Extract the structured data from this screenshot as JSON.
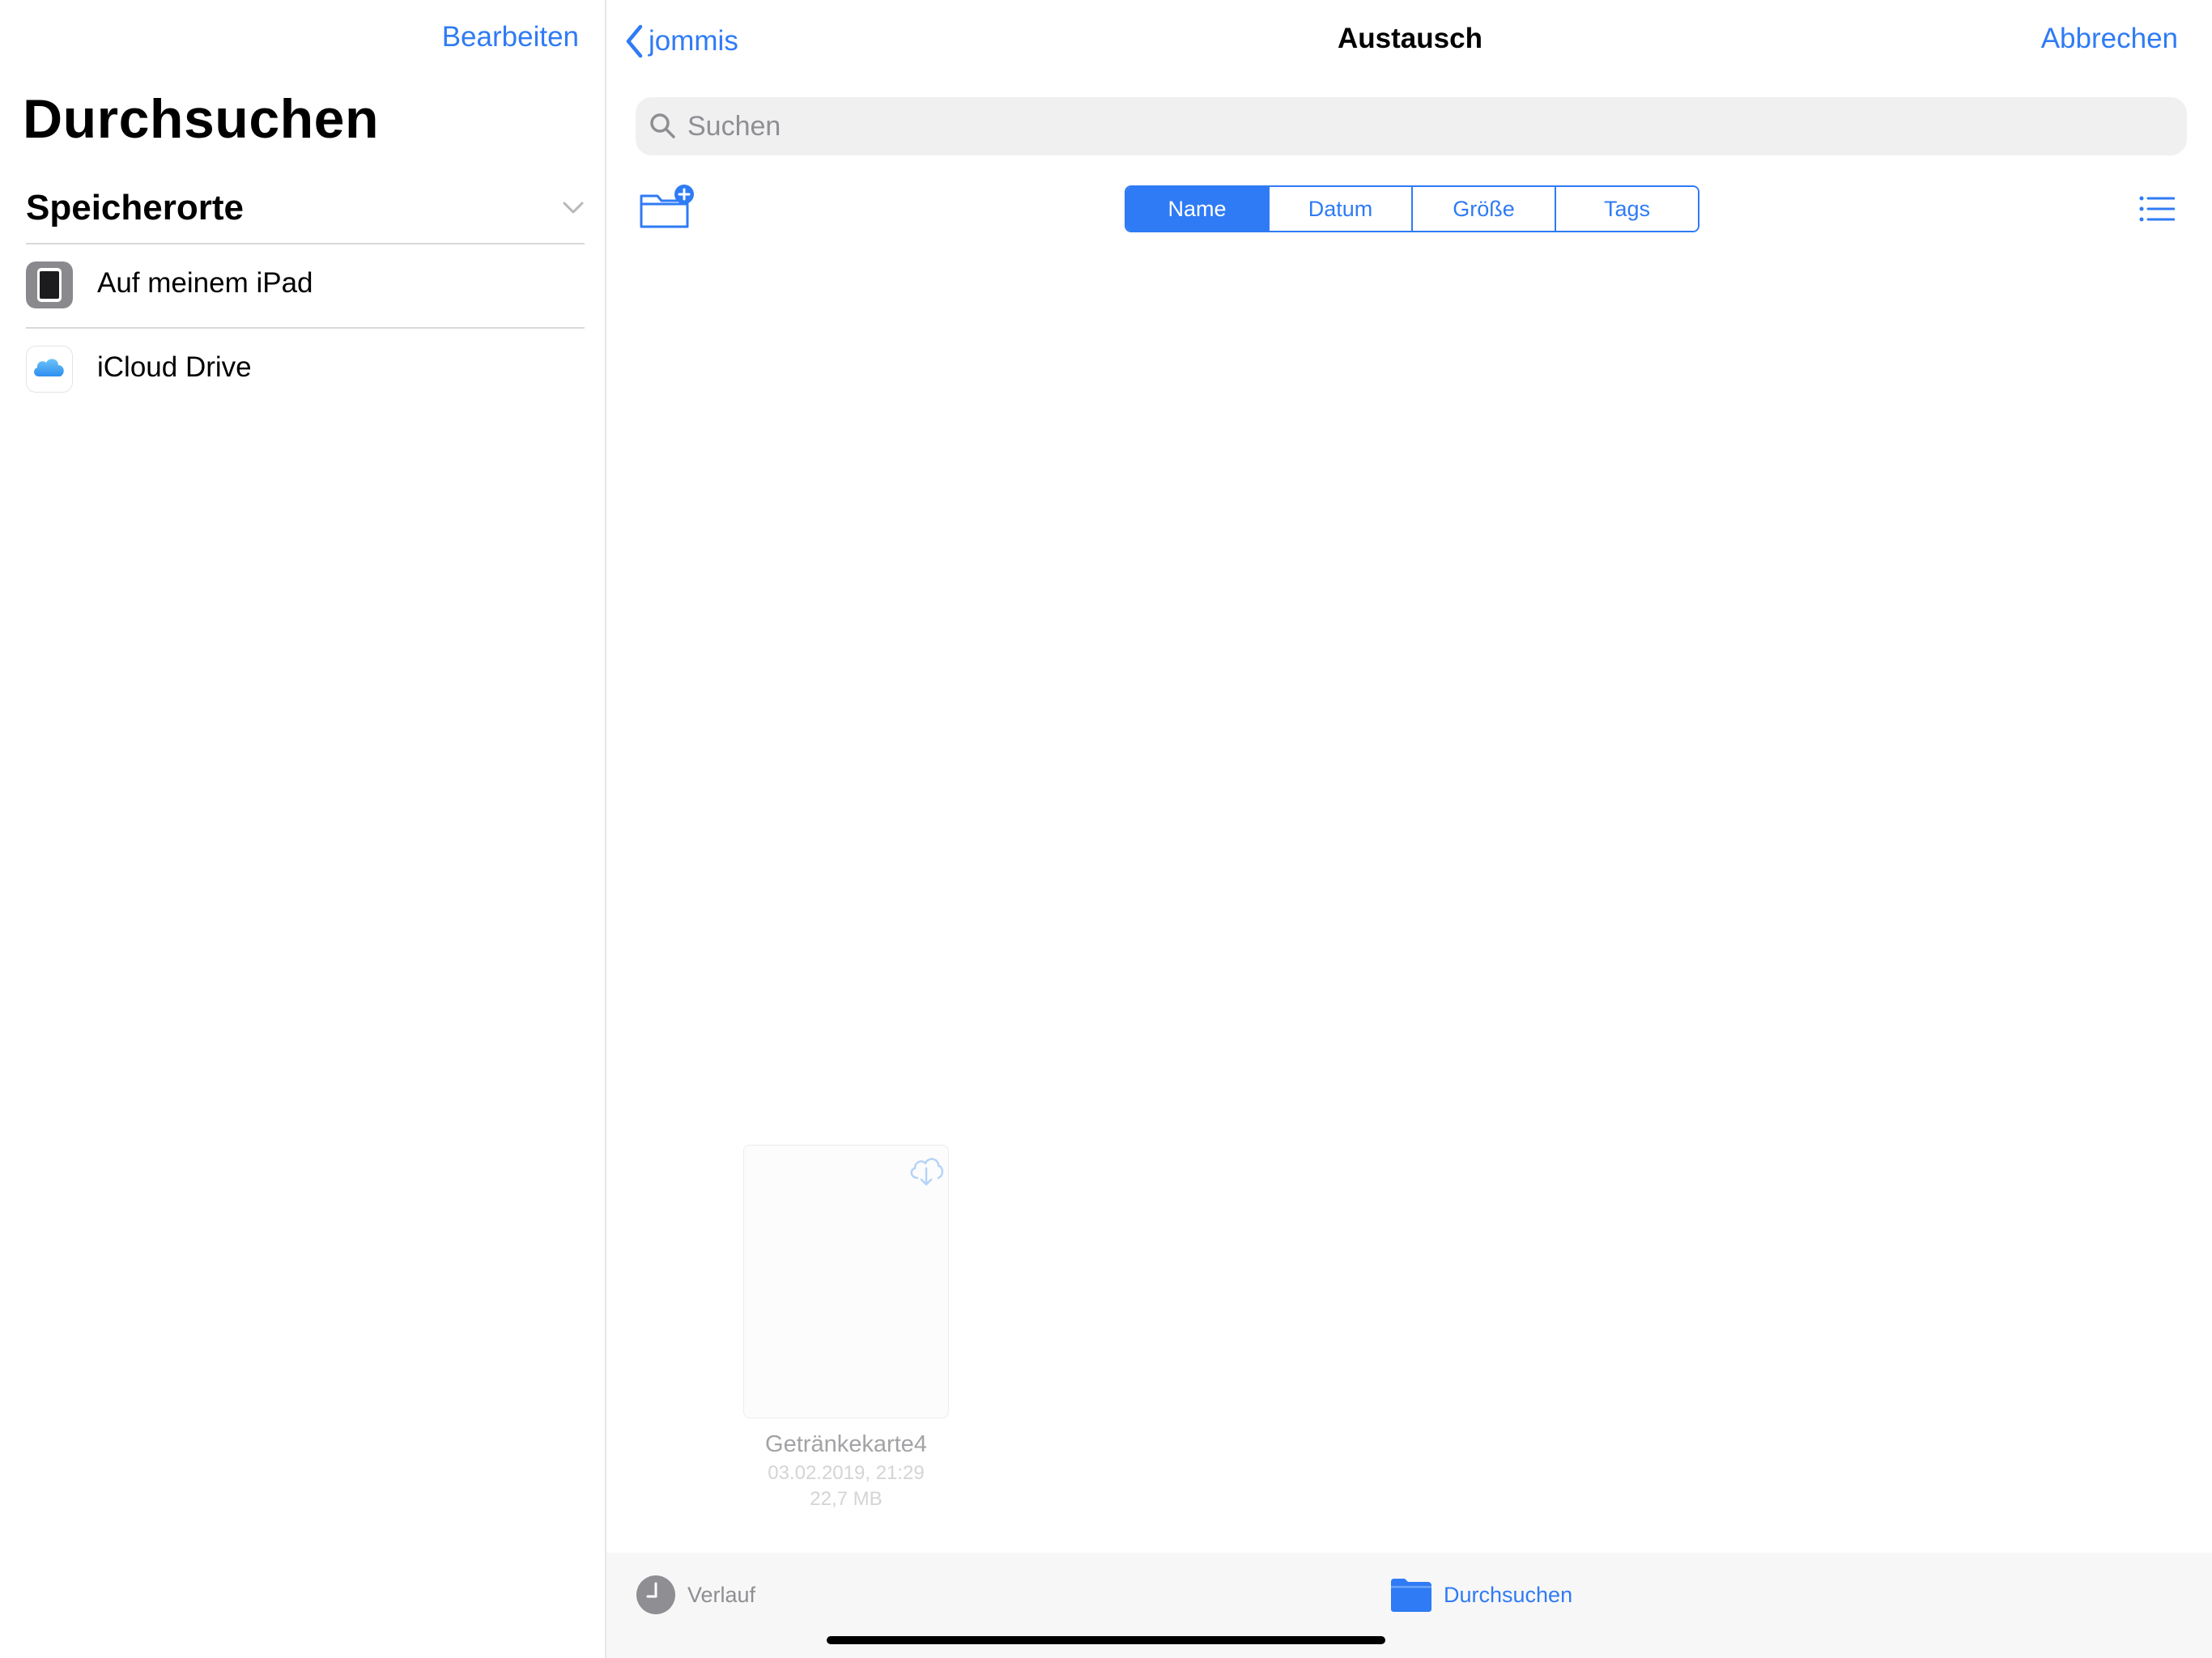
{
  "sidebar": {
    "edit_label": "Bearbeiten",
    "title": "Durchsuchen",
    "section_label": "Speicherorte",
    "items": [
      {
        "label": "Auf meinem iPad",
        "icon": "ipad-icon"
      },
      {
        "label": "iCloud Drive",
        "icon": "icloud-icon"
      }
    ]
  },
  "nav": {
    "back_label": "jommis",
    "title": "Austausch",
    "cancel_label": "Abbrechen"
  },
  "search": {
    "placeholder": "Suchen"
  },
  "sort": {
    "options": [
      "Name",
      "Datum",
      "Größe",
      "Tags"
    ],
    "selected": "Name"
  },
  "files": [
    {
      "name": "Getränkekarte4",
      "date": "03.02.2019, 21:29",
      "size": "22,7 MB",
      "status": "cloud-download"
    }
  ],
  "tabbar": {
    "recent_label": "Verlauf",
    "browse_label": "Durchsuchen",
    "selected": "Durchsuchen"
  },
  "colors": {
    "accent": "#2f7bf5",
    "secondary_text": "#8e8e93",
    "tabbar_bg": "#f7f7f7"
  }
}
